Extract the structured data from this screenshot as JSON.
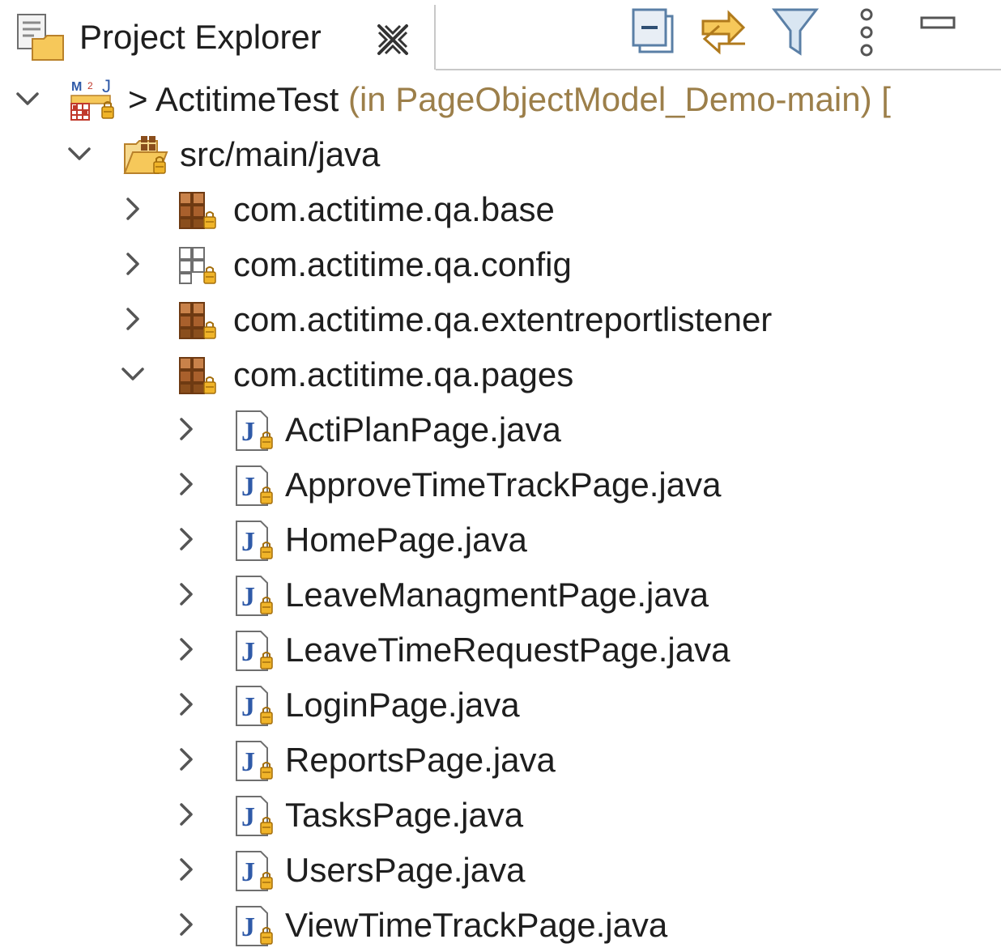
{
  "tab": {
    "title": "Project Explorer",
    "icon": "project-explorer-icon",
    "close_icon": "close-icon"
  },
  "toolbar": [
    {
      "name": "collapse-all-icon"
    },
    {
      "name": "link-with-editor-icon"
    },
    {
      "name": "filter-icon"
    },
    {
      "name": "view-menu-icon"
    },
    {
      "name": "minimize-icon"
    }
  ],
  "tree": {
    "project": {
      "prefix": ">",
      "name": "ActitimeTest",
      "detail": "(in PageObjectModel_Demo-main) [",
      "icon": "maven-java-project-icon",
      "expanded": true
    },
    "source_folder": {
      "name": "src/main/java",
      "icon": "source-folder-icon",
      "expanded": true
    },
    "packages": [
      {
        "name": "com.actitime.qa.base",
        "icon": "package-icon",
        "expanded": false
      },
      {
        "name": "com.actitime.qa.config",
        "icon": "empty-package-icon",
        "expanded": false
      },
      {
        "name": "com.actitime.qa.extentreportlistener",
        "icon": "package-icon",
        "expanded": false
      },
      {
        "name": "com.actitime.qa.pages",
        "icon": "package-icon",
        "expanded": true
      }
    ],
    "files": [
      "ActiPlanPage.java",
      "ApproveTimeTrackPage.java",
      "HomePage.java",
      "LeaveManagmentPage.java",
      "LeaveTimeRequestPage.java",
      "LoginPage.java",
      "ReportsPage.java",
      "TasksPage.java",
      "UsersPage.java",
      "ViewTimeTrackPage.java"
    ]
  },
  "colors": {
    "text": "#1e1e1e",
    "decoration": "#9c7f4a",
    "package_brown": "#8a4e1c",
    "lock_yellow": "#f0b429"
  }
}
